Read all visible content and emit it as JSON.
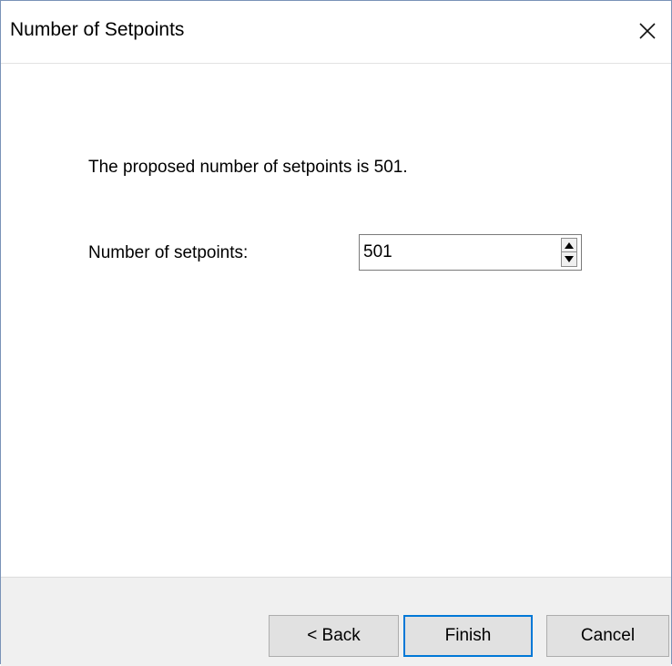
{
  "window": {
    "title": "Number of Setpoints",
    "close_icon": "close-icon"
  },
  "content": {
    "message": "The proposed number of setpoints is 501.",
    "setpoints_label": "Number of setpoints:",
    "setpoints_value": "501",
    "spin_up_icon": "triangle-up-icon",
    "spin_down_icon": "triangle-down-icon"
  },
  "buttons": {
    "back": "< Back",
    "finish": "Finish",
    "cancel": "Cancel"
  },
  "colors": {
    "default_button_border": "#0078d7",
    "footer_bg": "#f0f0f0"
  }
}
